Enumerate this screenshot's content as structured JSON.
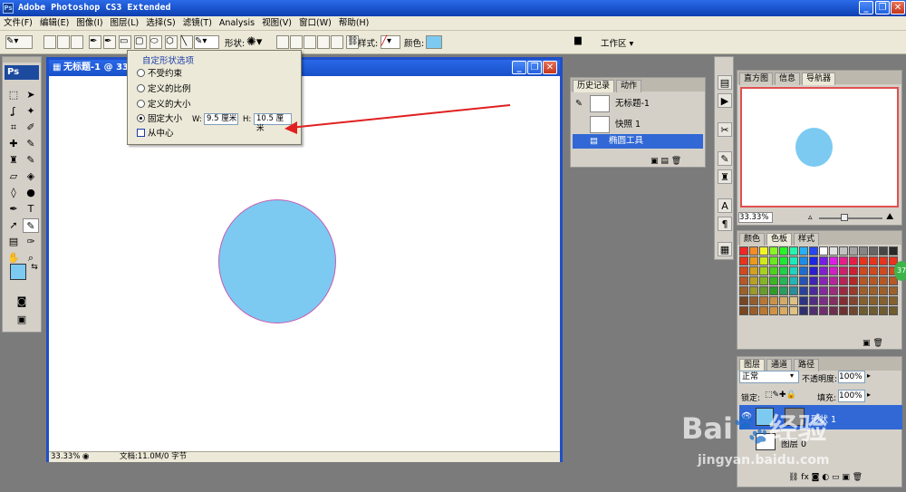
{
  "window": {
    "title": "Adobe Photoshop CS3 Extended",
    "logo": "Ps",
    "buttons": [
      "_",
      "❐",
      "✕"
    ]
  },
  "menu": [
    "文件(F)",
    "编辑(E)",
    "图像(I)",
    "图层(L)",
    "选择(S)",
    "滤镜(T)",
    "Analysis",
    "视图(V)",
    "窗口(W)",
    "帮助(H)"
  ],
  "options": {
    "shape_label": "形状:",
    "style_label": "样式:",
    "color_label": "颜色:",
    "workspace": "工作区 ▾",
    "fill_color": "#7ccaf2"
  },
  "dropdown": {
    "title": "自定形状选项",
    "opt_unconstrained": "不受约束",
    "opt_ratio": "定义的比例",
    "opt_size": "定义的大小",
    "opt_fixed": "固定大小",
    "w_label": "W:",
    "w_value": "9.5 厘米",
    "h_label": "H:",
    "h_value": "10.5 厘米",
    "from_center": "从中心"
  },
  "document": {
    "title": "无标题-1 @ 33",
    "zoom": "33.33%",
    "status": "文档:11.0M/0 字节",
    "shape_color": "#7ccaf2"
  },
  "panels": {
    "top_tabs": [
      "直方图",
      "信息",
      "导航器"
    ],
    "nav_zoom": "33.33%",
    "history_tabs": [
      "历史记录",
      "动作"
    ],
    "history": [
      "无标题-1",
      "快照 1",
      "椭圆工具"
    ],
    "color_tabs": [
      "颜色",
      "色板",
      "样式"
    ],
    "layer_tabs": [
      "图层",
      "通道",
      "路径"
    ],
    "blend": "正常",
    "opacity_label": "不透明度:",
    "opacity": "100%",
    "lock_label": "锁定:",
    "fill_label": "填充:",
    "fill": "100%",
    "layers": [
      "形状 1",
      "图层 0"
    ],
    "badge": "37"
  },
  "watermark": {
    "brand": "Bai",
    "brand2": "经验",
    "url": "jingyan.baidu.com"
  },
  "colors": {
    "accent": "#1f4fc8",
    "arrow": "#e02020"
  }
}
